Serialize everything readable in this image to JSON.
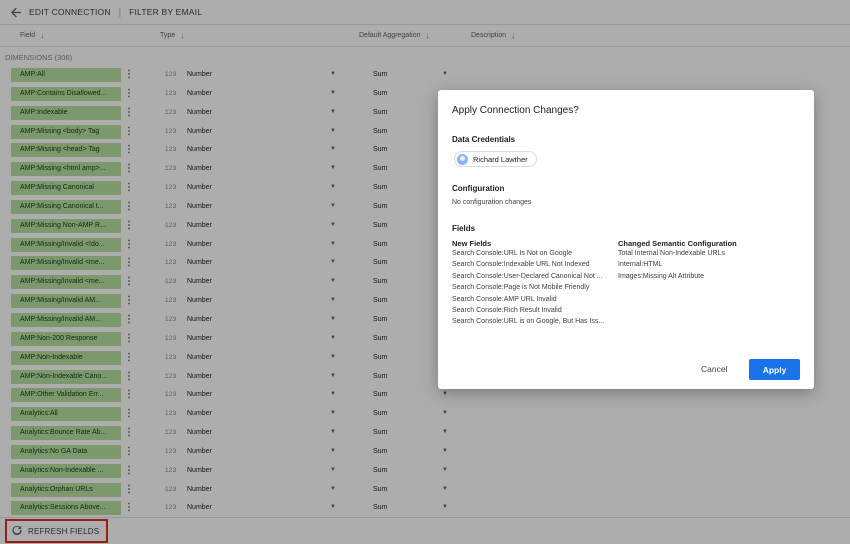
{
  "topbar": {
    "edit_connection": "EDIT CONNECTION",
    "separator": "|",
    "filter_by_email": "FILTER BY EMAIL"
  },
  "columns": {
    "field": "Field",
    "type": "Type",
    "aggregation": "Default Aggregation",
    "description": "Description"
  },
  "section_label": "DIMENSIONS (306)",
  "rows": [
    {
      "field": "AMP:All",
      "type": "Number",
      "agg": "Sum"
    },
    {
      "field": "AMP:Contains Disallowed...",
      "type": "Number",
      "agg": "Sum"
    },
    {
      "field": "AMP:Indexable",
      "type": "Number",
      "agg": "Sum"
    },
    {
      "field": "AMP:Missing <body> Tag",
      "type": "Number",
      "agg": "Sum"
    },
    {
      "field": "AMP:Missing <head> Tag",
      "type": "Number",
      "agg": "Sum"
    },
    {
      "field": "AMP:Missing <html amp>...",
      "type": "Number",
      "agg": "Sum"
    },
    {
      "field": "AMP:Missing Canonical",
      "type": "Number",
      "agg": "Sum"
    },
    {
      "field": "AMP:Missing Canonical t...",
      "type": "Number",
      "agg": "Sum"
    },
    {
      "field": "AMP:Missing Non-AMP R...",
      "type": "Number",
      "agg": "Sum"
    },
    {
      "field": "AMP:Missing/Invalid <!do...",
      "type": "Number",
      "agg": "Sum"
    },
    {
      "field": "AMP:Missing/Invalid <me...",
      "type": "Number",
      "agg": "Sum"
    },
    {
      "field": "AMP:Missing/Invalid <me...",
      "type": "Number",
      "agg": "Sum"
    },
    {
      "field": "AMP:Missing/Invalid AM...",
      "type": "Number",
      "agg": "Sum"
    },
    {
      "field": "AMP:Missing/Invalid AM...",
      "type": "Number",
      "agg": "Sum"
    },
    {
      "field": "AMP:Non-200 Response",
      "type": "Number",
      "agg": "Sum"
    },
    {
      "field": "AMP:Non-Indexable",
      "type": "Number",
      "agg": "Sum"
    },
    {
      "field": "AMP:Non-Indexable Cano...",
      "type": "Number",
      "agg": "Sum"
    },
    {
      "field": "AMP:Other Validation Err...",
      "type": "Number",
      "agg": "Sum"
    },
    {
      "field": "Analytics:All",
      "type": "Number",
      "agg": "Sum"
    },
    {
      "field": "Analytics:Bounce Rate Ab...",
      "type": "Number",
      "agg": "Sum"
    },
    {
      "field": "Analytics:No GA Data",
      "type": "Number",
      "agg": "Sum"
    },
    {
      "field": "Analytics:Non-Indexable ...",
      "type": "Number",
      "agg": "Sum"
    },
    {
      "field": "Analytics:Orphan URLs",
      "type": "Number",
      "agg": "Sum"
    },
    {
      "field": "Analytics:Sessions Above...",
      "type": "Number",
      "agg": "Sum"
    }
  ],
  "number_icon_text": "123",
  "footer": {
    "refresh_label": "REFRESH FIELDS"
  },
  "dialog": {
    "title": "Apply Connection Changes?",
    "credentials_heading": "Data Credentials",
    "user_name": "Richard Lawther",
    "configuration_heading": "Configuration",
    "configuration_text": "No configuration changes",
    "fields_heading": "Fields",
    "new_fields_heading": "New Fields",
    "new_fields": [
      "Search Console:URL Is Not on Google",
      "Search Console:Indexable URL Not Indexed",
      "Search Console:User-Declared Canonical Not ...",
      "Search Console:Page is Not Mobile Friendly",
      "Search Console:AMP URL Invalid",
      "Search Console:Rich Result Invalid",
      "Search Console:URL is on Google, But Has Iss..."
    ],
    "changed_heading": "Changed Semantic Configuration",
    "changed_fields": [
      "Total Internal Non-Indexable URLs",
      "Internal:HTML",
      "Images:Missing Alt Attribute"
    ],
    "cancel_label": "Cancel",
    "apply_label": "Apply"
  },
  "colors": {
    "chip_green": "#b7e1a1",
    "primary_blue": "#1a73e8",
    "highlight_red": "#d93025"
  }
}
